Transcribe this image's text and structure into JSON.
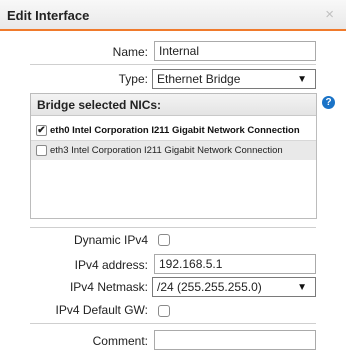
{
  "dialog": {
    "title": "Edit Interface",
    "close_icon": "×"
  },
  "name": {
    "label": "Name:",
    "value": "Internal"
  },
  "type": {
    "label": "Type:",
    "value": "Ethernet Bridge"
  },
  "bridge": {
    "header": "Bridge selected NICs:",
    "help_icon": "?",
    "nics": [
      {
        "label": "eth0 Intel Corporation I211 Gigabit Network Connection",
        "checked": true
      },
      {
        "label": "eth3 Intel Corporation I211 Gigabit Network Connection",
        "checked": false
      }
    ]
  },
  "dynamic_ipv4": {
    "label": "Dynamic IPv4",
    "checked": false
  },
  "ipv4_address": {
    "label": "IPv4 address:",
    "value": "192.168.5.1"
  },
  "ipv4_netmask": {
    "label": "IPv4 Netmask:",
    "value": "/24 (255.255.255.0)"
  },
  "ipv4_default_gw": {
    "label": "IPv4 Default GW:",
    "checked": false
  },
  "comment": {
    "label": "Comment:",
    "value": ""
  },
  "colors": {
    "accent": "#f07a2b",
    "help": "#1a73c7"
  }
}
